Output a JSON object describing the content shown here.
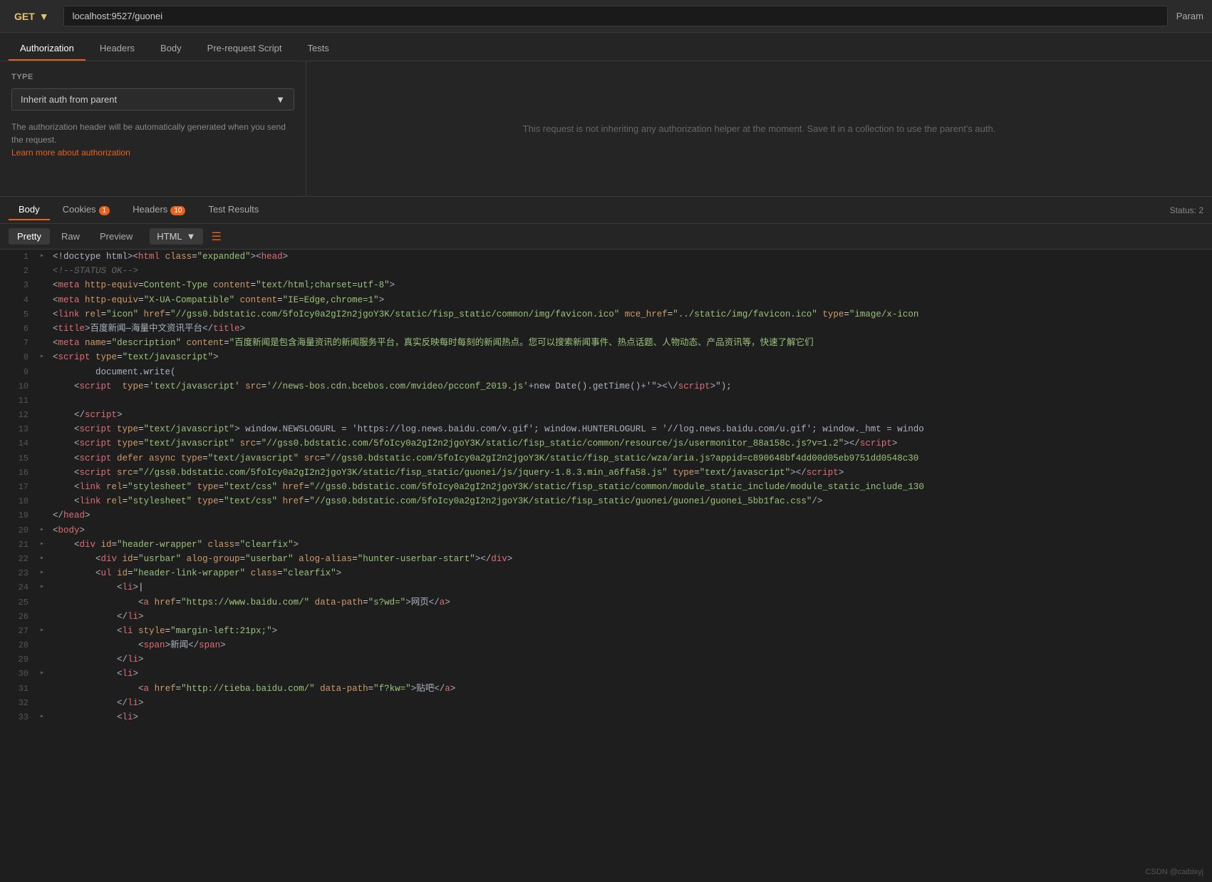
{
  "topbar": {
    "method": "GET",
    "method_chevron": "▼",
    "url": "localhost:9527/guonei",
    "param_label": "Param"
  },
  "request_tabs": [
    {
      "label": "Authorization",
      "active": true
    },
    {
      "label": "Headers",
      "active": false
    },
    {
      "label": "Body",
      "active": false
    },
    {
      "label": "Pre-request Script",
      "active": false
    },
    {
      "label": "Tests",
      "active": false
    }
  ],
  "auth": {
    "type_label": "TYPE",
    "dropdown_value": "Inherit auth from parent",
    "description_part1": "The authorization header will be automatically generated when you send the request.",
    "link_text": "Learn more about authorization",
    "info_text": "This request is not inheriting any authorization helper at the moment. Save it in a collection to use the parent's auth."
  },
  "response_tabs": [
    {
      "label": "Body",
      "active": true,
      "badge": null
    },
    {
      "label": "Cookies",
      "active": false,
      "badge": "1"
    },
    {
      "label": "Headers",
      "active": false,
      "badge": "10"
    },
    {
      "label": "Test Results",
      "active": false,
      "badge": null
    }
  ],
  "status_label": "Status: 2",
  "code_tabs": [
    {
      "label": "Pretty",
      "active": true
    },
    {
      "label": "Raw",
      "active": false
    },
    {
      "label": "Preview",
      "active": false
    }
  ],
  "format": "HTML",
  "watermark": "CSDN @caibixyj",
  "code_lines": [
    {
      "num": 1,
      "expand": "▸",
      "html": "<span class='c-white'>&lt;!doctype html&gt;&lt;</span><span class='c-tag'>html</span> <span class='c-attr'>class</span>=<span class='c-val'>\"expanded\"</span><span class='c-white'>&gt;&lt;</span><span class='c-tag'>head</span><span class='c-white'>&gt;</span>"
    },
    {
      "num": 2,
      "expand": " ",
      "html": "<span class='c-comment'>&lt;!--STATUS OK--&gt;</span>"
    },
    {
      "num": 3,
      "expand": " ",
      "html": "<span class='c-white'>&lt;</span><span class='c-tag'>meta</span> <span class='c-attr'>http-equiv</span>=<span class='c-val'>Content-Type</span> <span class='c-attr'>content</span>=<span class='c-val'>\"text/html;charset=utf-8\"</span><span class='c-white'>&gt;</span>"
    },
    {
      "num": 4,
      "expand": " ",
      "html": "<span class='c-white'>&lt;</span><span class='c-tag'>meta</span> <span class='c-attr'>http-equiv</span>=<span class='c-val'>\"X-UA-Compatible\"</span> <span class='c-attr'>content</span>=<span class='c-val'>\"IE=Edge,chrome=1\"</span><span class='c-white'>&gt;</span>"
    },
    {
      "num": 5,
      "expand": " ",
      "html": "<span class='c-white'>&lt;</span><span class='c-tag'>link</span> <span class='c-attr'>rel</span>=<span class='c-val'>\"icon\"</span> <span class='c-attr'>href</span>=<span class='c-val'>\"//gss0.bdstatic.com/5foIcy0a2gI2n2jgoY3K/static/fisp_static/common/img/favicon.ico\"</span> <span class='c-attr'>mce_href</span>=<span class='c-val'>\"../static/img/favicon.ico\"</span> <span class='c-attr'>type</span>=<span class='c-val'>\"image/x-icon</span>"
    },
    {
      "num": 6,
      "expand": " ",
      "html": "<span class='c-white'>&lt;</span><span class='c-tag'>title</span><span class='c-white'>&gt;</span><span class='c-text'>百度新闻—海量中文资讯平台</span><span class='c-white'>&lt;/</span><span class='c-tag'>title</span><span class='c-white'>&gt;</span>"
    },
    {
      "num": 7,
      "expand": " ",
      "html": "<span class='c-white'>&lt;</span><span class='c-tag'>meta</span> <span class='c-attr'>name</span>=<span class='c-val'>\"description\"</span> <span class='c-attr'>content</span>=<span class='c-val'>\"百度新闻是包含海量资讯的新闻服务平台，真实反映每时每刻的新闻热点。您可以搜索新闻事件、热点话题、人物动态、产品资讯等，快速了解它们</span>"
    },
    {
      "num": 8,
      "expand": "▸",
      "html": "<span class='c-white'>&lt;</span><span class='c-tag'>script</span> <span class='c-attr'>type</span>=<span class='c-val'>\"text/javascript\"</span><span class='c-white'>&gt;</span>"
    },
    {
      "num": 9,
      "expand": " ",
      "html": "<span class='c-white'>        document.write(</span>"
    },
    {
      "num": 10,
      "expand": " ",
      "html": "<span class='c-white'>    &lt;</span><span class='c-tag'>script</span>  <span class='c-attr'>type</span>=<span class='c-val'>'text/javascript'</span> <span class='c-attr'>src</span>=<span class='c-val'>'//news-bos.cdn.bcebos.com/mvideo/pcconf_2019.js'</span><span class='c-white'>+new Date().getTime()+'\"&gt;&lt;\\/</span><span class='c-tag'>script</span><span class='c-white'>&gt;\"</span><span class='c-white'>);</span>"
    },
    {
      "num": 11,
      "expand": " ",
      "html": ""
    },
    {
      "num": 12,
      "expand": " ",
      "html": "<span class='c-white'>    &lt;/</span><span class='c-tag'>script</span><span class='c-white'>&gt;</span>"
    },
    {
      "num": 13,
      "expand": " ",
      "html": "<span class='c-white'>    &lt;</span><span class='c-tag'>script</span> <span class='c-attr'>type</span>=<span class='c-val'>\"text/javascript\"</span><span class='c-white'>&gt; window.NEWSLOGURL = 'https://log.news.baidu.com/v.gif'; window.HUNTERLOGURL = '//log.news.baidu.com/u.gif'; window._hmt =</span> <span class='c-text'>windo</span>"
    },
    {
      "num": 14,
      "expand": " ",
      "html": "<span class='c-white'>    &lt;</span><span class='c-tag'>script</span> <span class='c-attr'>type</span>=<span class='c-val'>\"text/javascript\"</span> <span class='c-attr'>src</span>=<span class='c-val'>\"//gss0.bdstatic.com/5foIcy0a2gI2n2jgoY3K/static/fisp_static/common/resource/js/usermonitor_88a158c.js?v=1.2\"</span><span class='c-white'>&gt;&lt;/</span><span class='c-tag'>script</span><span class='c-white'>&gt;</span>"
    },
    {
      "num": 15,
      "expand": " ",
      "html": "<span class='c-white'>    &lt;</span><span class='c-tag'>script</span> <span class='c-attr'>defer async type</span>=<span class='c-val'>\"text/javascript\"</span> <span class='c-attr'>src</span>=<span class='c-val'>\"//gss0.bdstatic.com/5foIcy0a2gI2n2jgoY3K/static/fisp_static/wza/aria.js?appid=c890648bf4dd00d05eb9751dd0548c30</span>"
    },
    {
      "num": 16,
      "expand": " ",
      "html": "<span class='c-white'>    &lt;</span><span class='c-tag'>script</span> <span class='c-attr'>src</span>=<span class='c-val'>\"//gss0.bdstatic.com/5foIcy0a2gI2n2jgoY3K/static/fisp_static/guonei/js/jquery-1.8.3.min_a6ffa58.js\"</span> <span class='c-attr'>type</span>=<span class='c-val'>\"text/javascript\"</span><span class='c-white'>&gt;&lt;/</span><span class='c-tag'>script</span><span class='c-white'>&gt;</span>"
    },
    {
      "num": 17,
      "expand": " ",
      "html": "<span class='c-white'>    &lt;</span><span class='c-tag'>link</span> <span class='c-attr'>rel</span>=<span class='c-val'>\"stylesheet\"</span> <span class='c-attr'>type</span>=<span class='c-val'>\"text/css\"</span> <span class='c-attr'>href</span>=<span class='c-val'>\"//gss0.bdstatic.com/5foIcy0a2gI2n2jgoY3K/static/fisp_static/common/module_static_include/module_static_include_130</span>"
    },
    {
      "num": 18,
      "expand": " ",
      "html": "<span class='c-white'>    &lt;</span><span class='c-tag'>link</span> <span class='c-attr'>rel</span>=<span class='c-val'>\"stylesheet\"</span> <span class='c-attr'>type</span>=<span class='c-val'>\"text/css\"</span> <span class='c-attr'>href</span>=<span class='c-val'>\"//gss0.bdstatic.com/5foIcy0a2gI2n2jgoY3K/static/fisp_static/guonei/guonei/guonei_5bb1fac.css\"</span><span class='c-white'>/&gt;</span>"
    },
    {
      "num": 19,
      "expand": " ",
      "html": "<span class='c-white'>&lt;/</span><span class='c-tag'>head</span><span class='c-white'>&gt;</span>"
    },
    {
      "num": 20,
      "expand": "▸",
      "html": "<span class='c-white'>&lt;</span><span class='c-tag'>body</span><span class='c-white'>&gt;</span>"
    },
    {
      "num": 21,
      "expand": "▸",
      "html": "<span class='c-white'>    &lt;</span><span class='c-tag'>div</span> <span class='c-attr'>id</span>=<span class='c-val'>\"header-wrapper\"</span> <span class='c-attr'>class</span>=<span class='c-val'>\"clearfix\"</span><span class='c-white'>&gt;</span>"
    },
    {
      "num": 22,
      "expand": "▸",
      "html": "<span class='c-white'>        &lt;</span><span class='c-tag'>div</span> <span class='c-attr'>id</span>=<span class='c-val'>\"usrbar\"</span> <span class='c-attr'>alog-group</span>=<span class='c-val'>\"userbar\"</span> <span class='c-attr'>alog-alias</span>=<span class='c-val'>\"hunter-userbar-start\"</span><span class='c-white'>&gt;&lt;/</span><span class='c-tag'>div</span><span class='c-white'>&gt;</span>"
    },
    {
      "num": 23,
      "expand": "▸",
      "html": "<span class='c-white'>        &lt;</span><span class='c-tag'>ul</span> <span class='c-attr'>id</span>=<span class='c-val'>\"header-link-wrapper\"</span> <span class='c-attr'>class</span>=<span class='c-val'>\"clearfix\"</span><span class='c-white'>&gt;</span>"
    },
    {
      "num": 24,
      "expand": "▸",
      "html": "<span class='c-white'>            &lt;</span><span class='c-tag'>li</span><span class='c-white'>&gt;</span>|"
    },
    {
      "num": 25,
      "expand": " ",
      "html": "<span class='c-white'>                &lt;</span><span class='c-tag'>a</span> <span class='c-attr'>href</span>=<span class='c-val'>\"https://www.baidu.com/\"</span> <span class='c-attr'>data-path</span>=<span class='c-val'>\"s?wd=\"</span><span class='c-white'>&gt;</span><span class='c-text'>网页</span><span class='c-white'>&lt;/</span><span class='c-tag'>a</span><span class='c-white'>&gt;</span>"
    },
    {
      "num": 26,
      "expand": " ",
      "html": "<span class='c-white'>            &lt;/</span><span class='c-tag'>li</span><span class='c-white'>&gt;</span>"
    },
    {
      "num": 27,
      "expand": "▸",
      "html": "<span class='c-white'>            &lt;</span><span class='c-tag'>li</span> <span class='c-attr'>style</span>=<span class='c-val'>\"margin-left:21px;\"</span><span class='c-white'>&gt;</span>"
    },
    {
      "num": 28,
      "expand": " ",
      "html": "<span class='c-white'>                &lt;</span><span class='c-tag'>span</span><span class='c-white'>&gt;</span><span class='c-text'>新闻</span><span class='c-white'>&lt;/</span><span class='c-tag'>span</span><span class='c-white'>&gt;</span>"
    },
    {
      "num": 29,
      "expand": " ",
      "html": "<span class='c-white'>            &lt;/</span><span class='c-tag'>li</span><span class='c-white'>&gt;</span>"
    },
    {
      "num": 30,
      "expand": "▸",
      "html": "<span class='c-white'>            &lt;</span><span class='c-tag'>li</span><span class='c-white'>&gt;</span>"
    },
    {
      "num": 31,
      "expand": " ",
      "html": "<span class='c-white'>                &lt;</span><span class='c-tag'>a</span> <span class='c-attr'>href</span>=<span class='c-val'>\"http://tieba.baidu.com/\"</span> <span class='c-attr'>data-path</span>=<span class='c-val'>\"f?kw=\"</span><span class='c-white'>&gt;</span><span class='c-text'>贴吧</span><span class='c-white'>&lt;/</span><span class='c-tag'>a</span><span class='c-white'>&gt;</span>"
    },
    {
      "num": 32,
      "expand": " ",
      "html": "<span class='c-white'>            &lt;/</span><span class='c-tag'>li</span><span class='c-white'>&gt;</span>"
    },
    {
      "num": 33,
      "expand": "▸",
      "html": "<span class='c-white'>            &lt;</span><span class='c-tag'>li</span><span class='c-white'>&gt;</span>"
    }
  ]
}
